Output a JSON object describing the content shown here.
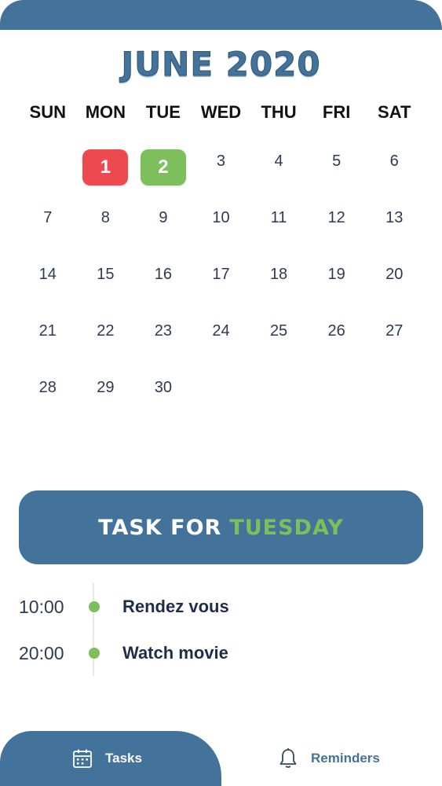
{
  "header": {
    "month_title": "JUNE 2020"
  },
  "weekdays": [
    "SUN",
    "MON",
    "TUE",
    "WED",
    "THU",
    "FRI",
    "SAT"
  ],
  "days": [
    "",
    "1",
    "2",
    "3",
    "4",
    "5",
    "6",
    "7",
    "8",
    "9",
    "10",
    "11",
    "12",
    "13",
    "14",
    "15",
    "16",
    "17",
    "18",
    "19",
    "20",
    "21",
    "22",
    "23",
    "24",
    "25",
    "26",
    "27",
    "28",
    "29",
    "30"
  ],
  "highlights": {
    "1": "red",
    "2": "green"
  },
  "colors": {
    "primary": "#43739a",
    "accent_green": "#7cbf5b",
    "accent_red": "#ec4a4f"
  },
  "task_banner": {
    "prefix": "TASK FOR",
    "day": "TUESDAY"
  },
  "tasks": [
    {
      "time": "10:00",
      "title": "Rendez vous"
    },
    {
      "time": "20:00",
      "title": "Watch movie"
    }
  ],
  "nav": {
    "tasks": {
      "label": "Tasks",
      "icon": "calendar-icon"
    },
    "reminders": {
      "label": "Reminders",
      "icon": "bell-icon"
    }
  }
}
